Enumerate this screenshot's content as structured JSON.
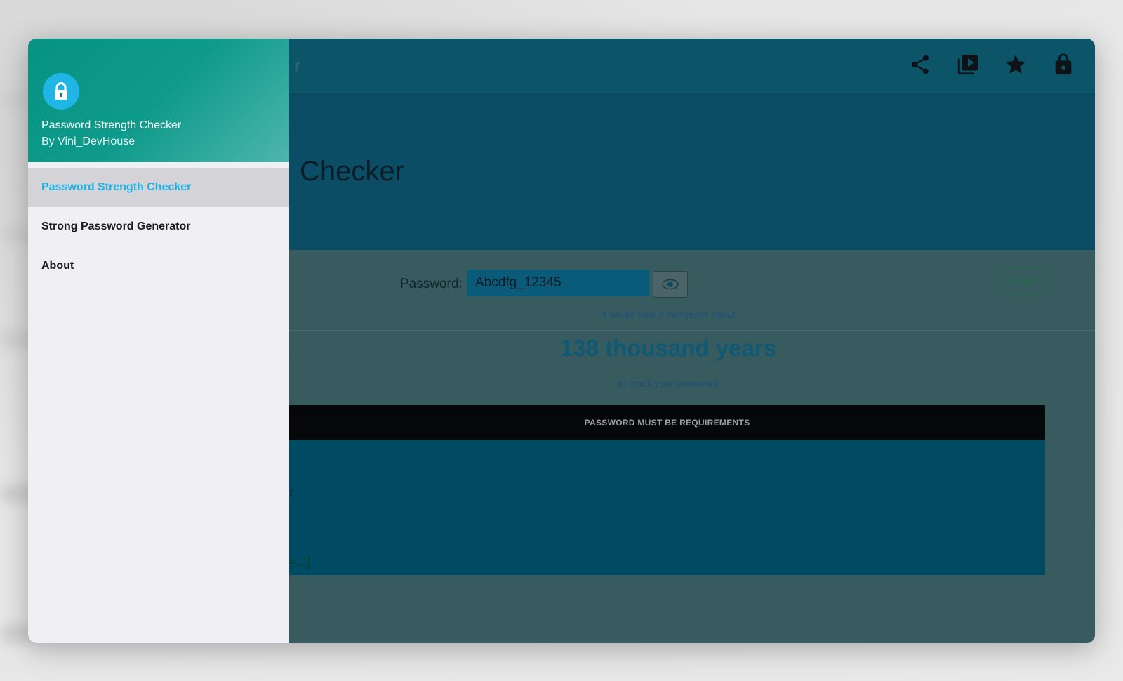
{
  "app_bar": {
    "title_fragment": "r",
    "actions": [
      {
        "name": "share-icon"
      },
      {
        "name": "video-library-icon"
      },
      {
        "name": "star-icon"
      },
      {
        "name": "lock-icon"
      }
    ]
  },
  "hero": {
    "title_fragment": "Checker"
  },
  "checker": {
    "password_label": "Password:",
    "password_value": "Abcdfg_12345",
    "eye_icon": "eye-icon",
    "copy_label": "Copy",
    "crack_prefix": "It would take a computer about",
    "crack_time": "138 thousand years",
    "crack_suffix": "to crack your password"
  },
  "requirements": {
    "header": "PASSWORD MUST BE REQUIREMENTS",
    "fragment_1": "r",
    "fragment_2": "=,.;]"
  },
  "drawer": {
    "avatar_icon": "lock-icon",
    "app_name": "Password Strength Checker",
    "author": "By Vini_DevHouse",
    "items": [
      {
        "label": "Password Strength Checker",
        "active": true
      },
      {
        "label": "Strong Password Generator",
        "active": false
      },
      {
        "label": "About",
        "active": false
      }
    ]
  },
  "colors": {
    "drawer_accent": "#20b1e2",
    "header_gradient_start": "#079383",
    "header_gradient_end": "#4db5ad",
    "app_bar": "#0c5468",
    "scrim_content": "#375b5e"
  }
}
